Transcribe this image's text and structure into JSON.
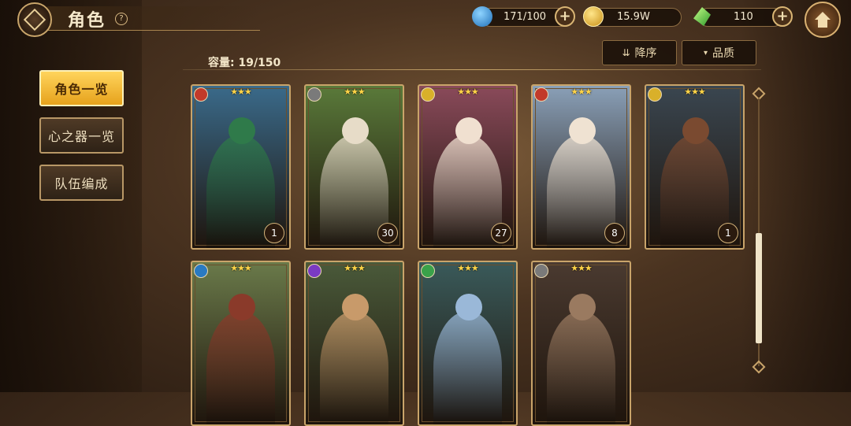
{
  "header": {
    "title": "角色",
    "help_icon": "question-icon",
    "back_icon": "diamond-back-icon",
    "home_icon": "home-icon"
  },
  "resources": [
    {
      "name": "stamina",
      "icon": "water-drop-icon",
      "value": "171/100",
      "color": "#3a9ad8"
    },
    {
      "name": "gold",
      "icon": "gold-coin-icon",
      "value": "15.9W",
      "color": "#e3b43a"
    },
    {
      "name": "gems",
      "icon": "green-crystal-icon",
      "value": "110",
      "color": "#5ec24a"
    }
  ],
  "capacity": "容量: 19/150",
  "sort": {
    "order_label": "降序",
    "order_icon": "sort-descending-icon",
    "filter_label": "品质",
    "filter_icon": "chevron-down-icon"
  },
  "menu": [
    {
      "label": "角色一览",
      "active": true
    },
    {
      "label": "心之器一览",
      "active": false
    },
    {
      "label": "队伍编成",
      "active": false
    }
  ],
  "cards": [
    {
      "stars": "★★★",
      "level": "1",
      "element": "fire",
      "elem_color": "#c23a2a",
      "bg": "#3a6a8a",
      "accent": "#2f7a4a"
    },
    {
      "stars": "★★★",
      "level": "30",
      "element": "neutral",
      "elem_color": "#7a7a7a",
      "bg": "#5a7a3a",
      "accent": "#e7dcc8"
    },
    {
      "stars": "★★★",
      "level": "27",
      "element": "light",
      "elem_color": "#d9b02a",
      "bg": "#8a4a5a",
      "accent": "#f0e0d0"
    },
    {
      "stars": "★★★",
      "level": "8",
      "element": "fire",
      "elem_color": "#c23a2a",
      "bg": "#8aa0b8",
      "accent": "#efe2d2"
    },
    {
      "stars": "★★★",
      "level": "1",
      "element": "light",
      "elem_color": "#d9b02a",
      "bg": "#3a4650",
      "accent": "#7a4a30"
    },
    {
      "stars": "★★★",
      "level": "",
      "element": "water",
      "elem_color": "#2a7ac2",
      "bg": "#6a7a4a",
      "accent": "#8a3a2a"
    },
    {
      "stars": "★★★",
      "level": "",
      "element": "dark",
      "elem_color": "#7a3ac2",
      "bg": "#4a5a3a",
      "accent": "#c89a6a"
    },
    {
      "stars": "★★★",
      "level": "",
      "element": "wind",
      "elem_color": "#3aa24a",
      "bg": "#3a5a5a",
      "accent": "#9ab8d8"
    },
    {
      "stars": "★★★",
      "level": "",
      "element": "neutral",
      "elem_color": "#7a7a7a",
      "bg": "#4a3a30",
      "accent": "#9a7a60"
    }
  ]
}
